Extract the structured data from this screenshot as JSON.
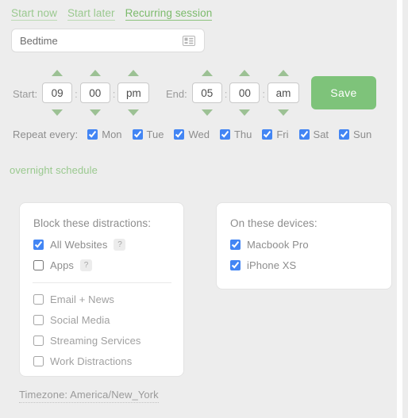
{
  "tabs": [
    {
      "label": "Start now",
      "active": false
    },
    {
      "label": "Start later",
      "active": false
    },
    {
      "label": "Recurring session",
      "active": true
    }
  ],
  "session_name": {
    "value": "Bedtime",
    "placeholder": "Session name",
    "icon": "contact-card-icon"
  },
  "schedule": {
    "start_label": "Start:",
    "start_hour": "09",
    "start_minute": "00",
    "start_meridiem": "pm",
    "end_label": "End:",
    "end_hour": "05",
    "end_minute": "00",
    "end_meridiem": "am",
    "separator": ":",
    "save_label": "Save",
    "overnight_note": "overnight schedule"
  },
  "repeat": {
    "label": "Repeat every:",
    "days": [
      {
        "label": "Mon",
        "checked": true
      },
      {
        "label": "Tue",
        "checked": true
      },
      {
        "label": "Wed",
        "checked": true
      },
      {
        "label": "Thu",
        "checked": true
      },
      {
        "label": "Fri",
        "checked": true
      },
      {
        "label": "Sat",
        "checked": true
      },
      {
        "label": "Sun",
        "checked": true
      }
    ]
  },
  "block_card": {
    "title": "Block these distractions:",
    "primary": [
      {
        "label": "All Websites",
        "checked": true,
        "help": "?"
      },
      {
        "label": "Apps",
        "checked": false,
        "help": "?"
      }
    ],
    "categories": [
      {
        "label": "Email + News",
        "checked": false
      },
      {
        "label": "Social Media",
        "checked": false
      },
      {
        "label": "Streaming Services",
        "checked": false
      },
      {
        "label": "Work Distractions",
        "checked": false
      }
    ]
  },
  "devices_card": {
    "title": "On these devices:",
    "devices": [
      {
        "label": "Macbook Pro",
        "checked": true
      },
      {
        "label": "iPhone XS",
        "checked": true
      }
    ]
  },
  "timezone": {
    "text": "Timezone: America/New_York"
  },
  "colors": {
    "background": "#ededed",
    "accent_green": "#7ec37a",
    "link_green": "#9ac98f",
    "active_link_green": "#7cbb6c",
    "arrow_green": "#9cc194",
    "checkbox_blue": "#4285f4",
    "card_background": "#ffffff",
    "text_grey": "#8d8d8d"
  }
}
